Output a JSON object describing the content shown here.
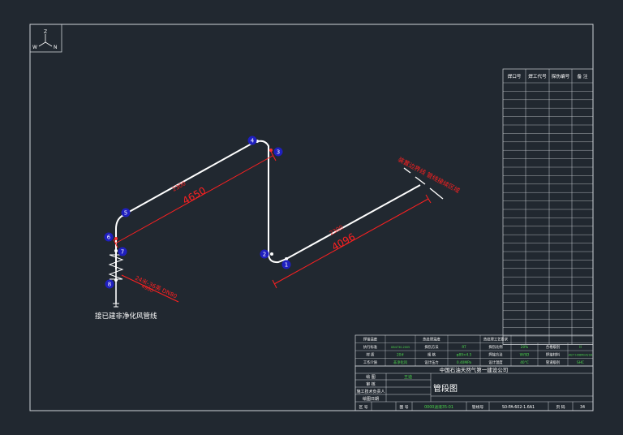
{
  "compass": {
    "z": "Z",
    "w": "W",
    "n": "N"
  },
  "points": [
    {
      "label": "1"
    },
    {
      "label": "2"
    },
    {
      "label": "3"
    },
    {
      "label": "4"
    },
    {
      "label": "5"
    },
    {
      "label": "6"
    },
    {
      "label": "7"
    },
    {
      "label": "8"
    }
  ],
  "dims": {
    "seg_upper_top": "2300",
    "seg_upper": "4650",
    "seg_lower_top": "2300",
    "seg_lower": "4096",
    "reducer_note": "24米-36英 DN80",
    "reducer_sub": "4900"
  },
  "annotations": {
    "branch_note": "接已建非净化风管线",
    "boundary_note": "装置边界线 管线接续区域"
  },
  "weld_table": {
    "headers": [
      "焊口号",
      "焊工代号",
      "探伤编号",
      "备 注"
    ],
    "row_count": 31
  },
  "spec_rows": [
    [
      "焊接温度",
      "",
      "热处理温度",
      "",
      "热处理工艺要求",
      ""
    ],
    [
      "执行标准",
      "GB4730-2005",
      "探伤方法",
      "RT",
      "探伤比例",
      "20%",
      "合格级别",
      "II"
    ],
    [
      "材 质",
      "20#",
      "规 格",
      "φ89×4.5",
      "焊接方法",
      "W/SD",
      "焊接材料",
      "J427 H08MnA2SA"
    ],
    [
      "工作介质",
      "非净化风",
      "设计压力",
      "0.40MPa",
      "设计温度",
      "40°C",
      "管道级别",
      "SHC"
    ]
  ],
  "title_block": {
    "company": "中国石油天然气第一建设公司",
    "drawing_title": "管段图",
    "rows": [
      {
        "label": "绘 图",
        "value": "王迪"
      },
      {
        "label": "审 核",
        "value": ""
      },
      {
        "label": "施工技术负责人",
        "value": ""
      },
      {
        "label": "绘图日期",
        "value": ""
      }
    ],
    "footer": {
      "zone_label": "区 号",
      "drawing_no_label": "图 号",
      "drawing_no": "0000滤液35-01",
      "line_no_label": "管线号",
      "line_no": "S0-PA-602-1.6A1",
      "page_label": "页 码",
      "page": "34"
    }
  },
  "colors": {
    "background": "#212830",
    "pipe": "#ffffff",
    "dimension": "#ff2020",
    "marker": "#1f1fbf",
    "frame": "#cfd3d8",
    "green_text": "#4cd84c"
  }
}
